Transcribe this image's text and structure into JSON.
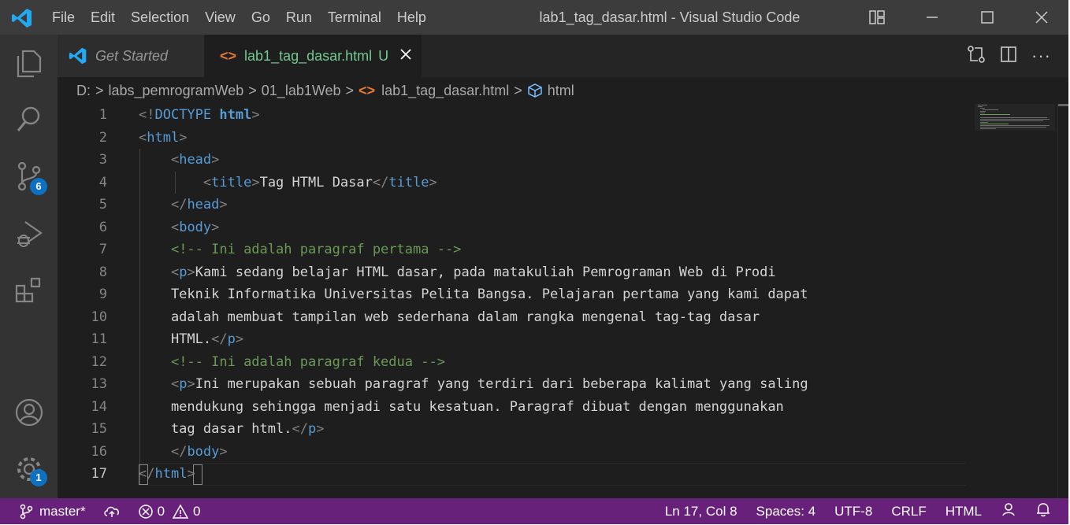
{
  "app": {
    "window_title": "lab1_tag_dasar.html - Visual Studio Code",
    "menu": [
      "File",
      "Edit",
      "Selection",
      "View",
      "Go",
      "Run",
      "Terminal",
      "Help"
    ]
  },
  "activity_bar": {
    "items": [
      {
        "name": "explorer",
        "icon": "files-icon"
      },
      {
        "name": "search",
        "icon": "search-icon"
      },
      {
        "name": "source-control",
        "icon": "source-control-icon",
        "badge": "6"
      },
      {
        "name": "run-debug",
        "icon": "run-debug-icon"
      },
      {
        "name": "extensions",
        "icon": "extensions-icon"
      }
    ],
    "bottom": [
      {
        "name": "accounts",
        "icon": "account-icon"
      },
      {
        "name": "manage",
        "icon": "gear-icon",
        "badge": "1"
      }
    ]
  },
  "tabs": [
    {
      "label": "Get Started",
      "active": false,
      "icon": "vscode-logo-icon"
    },
    {
      "label": "lab1_tag_dasar.html",
      "active": true,
      "status": "U",
      "icon": "html-file-icon"
    }
  ],
  "breadcrumbs": [
    "D:",
    "labs_pemrogramWeb",
    "01_lab1Web",
    "lab1_tag_dasar.html",
    "html"
  ],
  "editor": {
    "line_numbers": [
      "1",
      "2",
      "3",
      "4",
      "5",
      "6",
      "7",
      "8",
      "9",
      "10",
      "11",
      "12",
      "13",
      "14",
      "15",
      "16",
      "17"
    ],
    "active_line": "17",
    "lines": [
      [
        {
          "t": "bracket",
          "v": "<!"
        },
        {
          "t": "tag",
          "v": "DOCTYPE"
        },
        {
          "t": "text",
          "v": " "
        },
        {
          "t": "tag_bold",
          "v": "html"
        },
        {
          "t": "bracket",
          "v": ">"
        }
      ],
      [
        {
          "t": "bracket",
          "v": "<"
        },
        {
          "t": "tag",
          "v": "html"
        },
        {
          "t": "bracket",
          "v": ">"
        }
      ],
      [
        {
          "t": "text",
          "v": "    "
        },
        {
          "t": "bracket",
          "v": "<"
        },
        {
          "t": "tag",
          "v": "head"
        },
        {
          "t": "bracket",
          "v": ">"
        }
      ],
      [
        {
          "t": "text",
          "v": "        "
        },
        {
          "t": "bracket",
          "v": "<"
        },
        {
          "t": "tag",
          "v": "title"
        },
        {
          "t": "bracket",
          "v": ">"
        },
        {
          "t": "text",
          "v": "Tag HTML Dasar"
        },
        {
          "t": "bracket",
          "v": "</"
        },
        {
          "t": "tag",
          "v": "title"
        },
        {
          "t": "bracket",
          "v": ">"
        }
      ],
      [
        {
          "t": "text",
          "v": "    "
        },
        {
          "t": "bracket",
          "v": "</"
        },
        {
          "t": "tag",
          "v": "head"
        },
        {
          "t": "bracket",
          "v": ">"
        }
      ],
      [
        {
          "t": "text",
          "v": "    "
        },
        {
          "t": "bracket",
          "v": "<"
        },
        {
          "t": "tag",
          "v": "body"
        },
        {
          "t": "bracket",
          "v": ">"
        }
      ],
      [
        {
          "t": "text",
          "v": "    "
        },
        {
          "t": "comment",
          "v": "<!-- Ini adalah paragraf pertama -->"
        }
      ],
      [
        {
          "t": "text",
          "v": "    "
        },
        {
          "t": "bracket",
          "v": "<"
        },
        {
          "t": "tag",
          "v": "p"
        },
        {
          "t": "bracket",
          "v": ">"
        },
        {
          "t": "text",
          "v": "Kami sedang belajar HTML dasar, pada matakuliah Pemrograman Web di Prodi"
        }
      ],
      [
        {
          "t": "text",
          "v": "    Teknik Informatika Universitas Pelita Bangsa. Pelajaran pertama yang kami dapat"
        }
      ],
      [
        {
          "t": "text",
          "v": "    adalah membuat tampilan web sederhana dalam rangka mengenal tag-tag dasar"
        }
      ],
      [
        {
          "t": "text",
          "v": "    HTML."
        },
        {
          "t": "bracket",
          "v": "</"
        },
        {
          "t": "tag",
          "v": "p"
        },
        {
          "t": "bracket",
          "v": ">"
        }
      ],
      [
        {
          "t": "text",
          "v": "    "
        },
        {
          "t": "comment",
          "v": "<!-- Ini adalah paragraf kedua -->"
        }
      ],
      [
        {
          "t": "text",
          "v": "    "
        },
        {
          "t": "bracket",
          "v": "<"
        },
        {
          "t": "tag",
          "v": "p"
        },
        {
          "t": "bracket",
          "v": ">"
        },
        {
          "t": "text",
          "v": "Ini merupakan sebuah paragraf yang terdiri dari beberapa kalimat yang saling"
        }
      ],
      [
        {
          "t": "text",
          "v": "    mendukung sehingga menjadi satu kesatuan. Paragraf dibuat dengan menggunakan"
        }
      ],
      [
        {
          "t": "text",
          "v": "    tag dasar html."
        },
        {
          "t": "bracket",
          "v": "</"
        },
        {
          "t": "tag",
          "v": "p"
        },
        {
          "t": "bracket",
          "v": ">"
        }
      ],
      [
        {
          "t": "text",
          "v": "    "
        },
        {
          "t": "bracket",
          "v": "</"
        },
        {
          "t": "tag",
          "v": "body"
        },
        {
          "t": "bracket",
          "v": ">"
        }
      ],
      [
        {
          "t": "bracket",
          "v": "</"
        },
        {
          "t": "tag",
          "v": "html"
        },
        {
          "t": "bracket",
          "v": ">"
        }
      ]
    ]
  },
  "status_bar": {
    "branch": "master*",
    "errors": "0",
    "warnings": "0",
    "cursor": "Ln 17, Col 8",
    "spaces": "Spaces: 4",
    "encoding": "UTF-8",
    "eol": "CRLF",
    "language": "HTML"
  },
  "colors": {
    "status_bar": "#68217a",
    "tag": "#569cd6",
    "comment": "#6a9955",
    "badge": "#0e70c0",
    "tab_modified": "#73c991",
    "html_icon": "#e37933"
  }
}
